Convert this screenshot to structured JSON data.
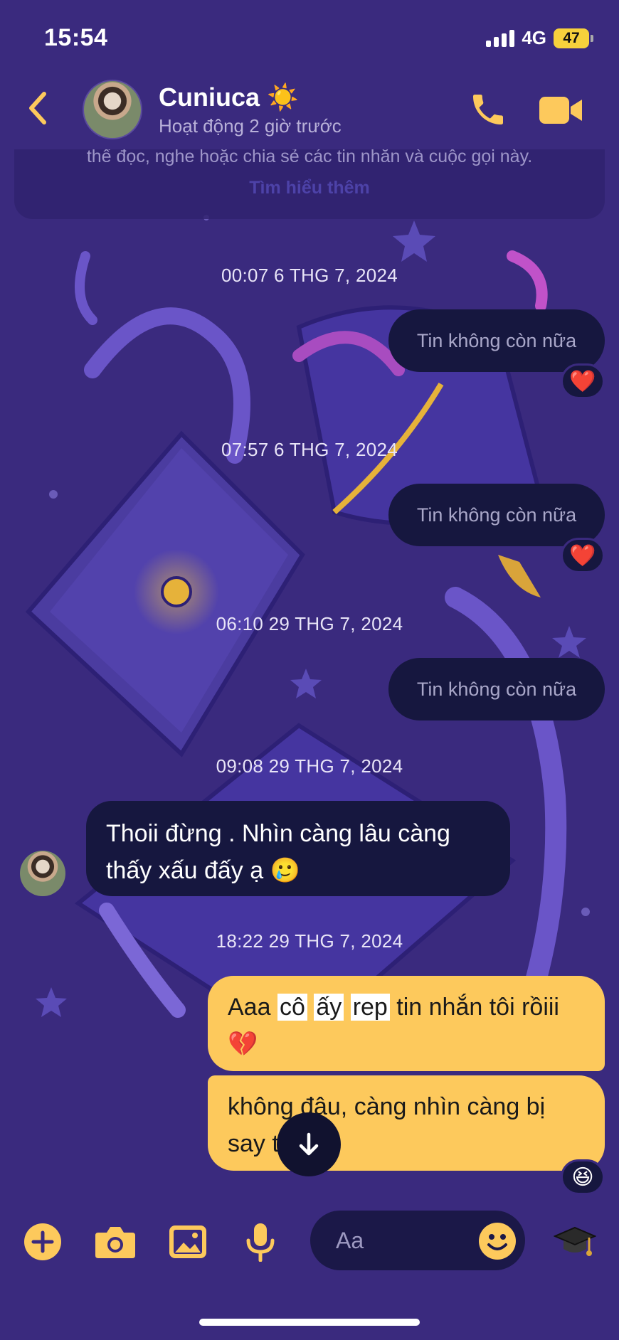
{
  "status_bar": {
    "time": "15:54",
    "network": "4G",
    "battery": "47"
  },
  "header": {
    "contact_name": "Cuniuca ☀️",
    "activity_status": "Hoạt động 2 giờ trước"
  },
  "notice": {
    "text": "thể đọc, nghe hoặc chia sẻ các tin nhắn và cuộc gọi này.",
    "link": "Tìm hiểu thêm"
  },
  "messages": {
    "ts1": "00:07 6 THG 7, 2024",
    "unsent1": "Tin không còn nữa",
    "reaction1": "❤️",
    "ts2": "07:57 6 THG 7, 2024",
    "unsent2": "Tin không còn nữa",
    "reaction2": "❤️",
    "ts3": "06:10 29 THG 7, 2024",
    "unsent3": "Tin không còn nữa",
    "ts4": "09:08 29 THG 7, 2024",
    "incoming_text": "Thoii đừng . Nhìn càng lâu càng thấy xấu đấy ạ 🥲",
    "ts5": "18:22 29 THG 7, 2024",
    "out1_a": "Aaa ",
    "out1_hl1": "cô",
    "out1_hl2": "ấy",
    "out1_hl3": "rep",
    "out1_b": " tin nhắn tôi rồiii 💔",
    "out2_text": "không đâu, càng nhìn càng bị say t  ấy",
    "reaction3": "😆"
  },
  "composer": {
    "placeholder": "Aa"
  },
  "colors": {
    "background": "#3a2a7e",
    "accent": "#fdc95c",
    "bubble_dark": "#16173f"
  }
}
